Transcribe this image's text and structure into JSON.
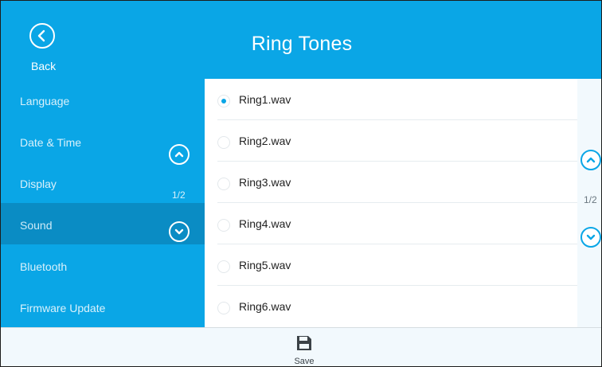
{
  "header": {
    "title": "Ring Tones",
    "back_label": "Back"
  },
  "sidebar": {
    "items": [
      {
        "label": "Language",
        "active": false
      },
      {
        "label": "Date & Time",
        "active": false
      },
      {
        "label": "Display",
        "active": false
      },
      {
        "label": "Sound",
        "active": true
      },
      {
        "label": "Bluetooth",
        "active": false
      },
      {
        "label": "Firmware Update",
        "active": false
      }
    ],
    "pager": "1/2"
  },
  "ringtones": {
    "items": [
      {
        "label": "Ring1.wav",
        "selected": true
      },
      {
        "label": "Ring2.wav",
        "selected": false
      },
      {
        "label": "Ring3.wav",
        "selected": false
      },
      {
        "label": "Ring4.wav",
        "selected": false
      },
      {
        "label": "Ring5.wav",
        "selected": false
      },
      {
        "label": "Ring6.wav",
        "selected": false
      }
    ],
    "pager": "1/2"
  },
  "footer": {
    "save_label": "Save"
  },
  "colors": {
    "accent": "#0aa6e6",
    "active_item": "#0a8cc4",
    "background": "#f2f9fd"
  },
  "icons": {
    "back": "chevron-left-circle-icon",
    "scroll_up": "chevron-up-circle-icon",
    "scroll_down": "chevron-down-circle-icon",
    "save": "floppy-disk-icon"
  }
}
